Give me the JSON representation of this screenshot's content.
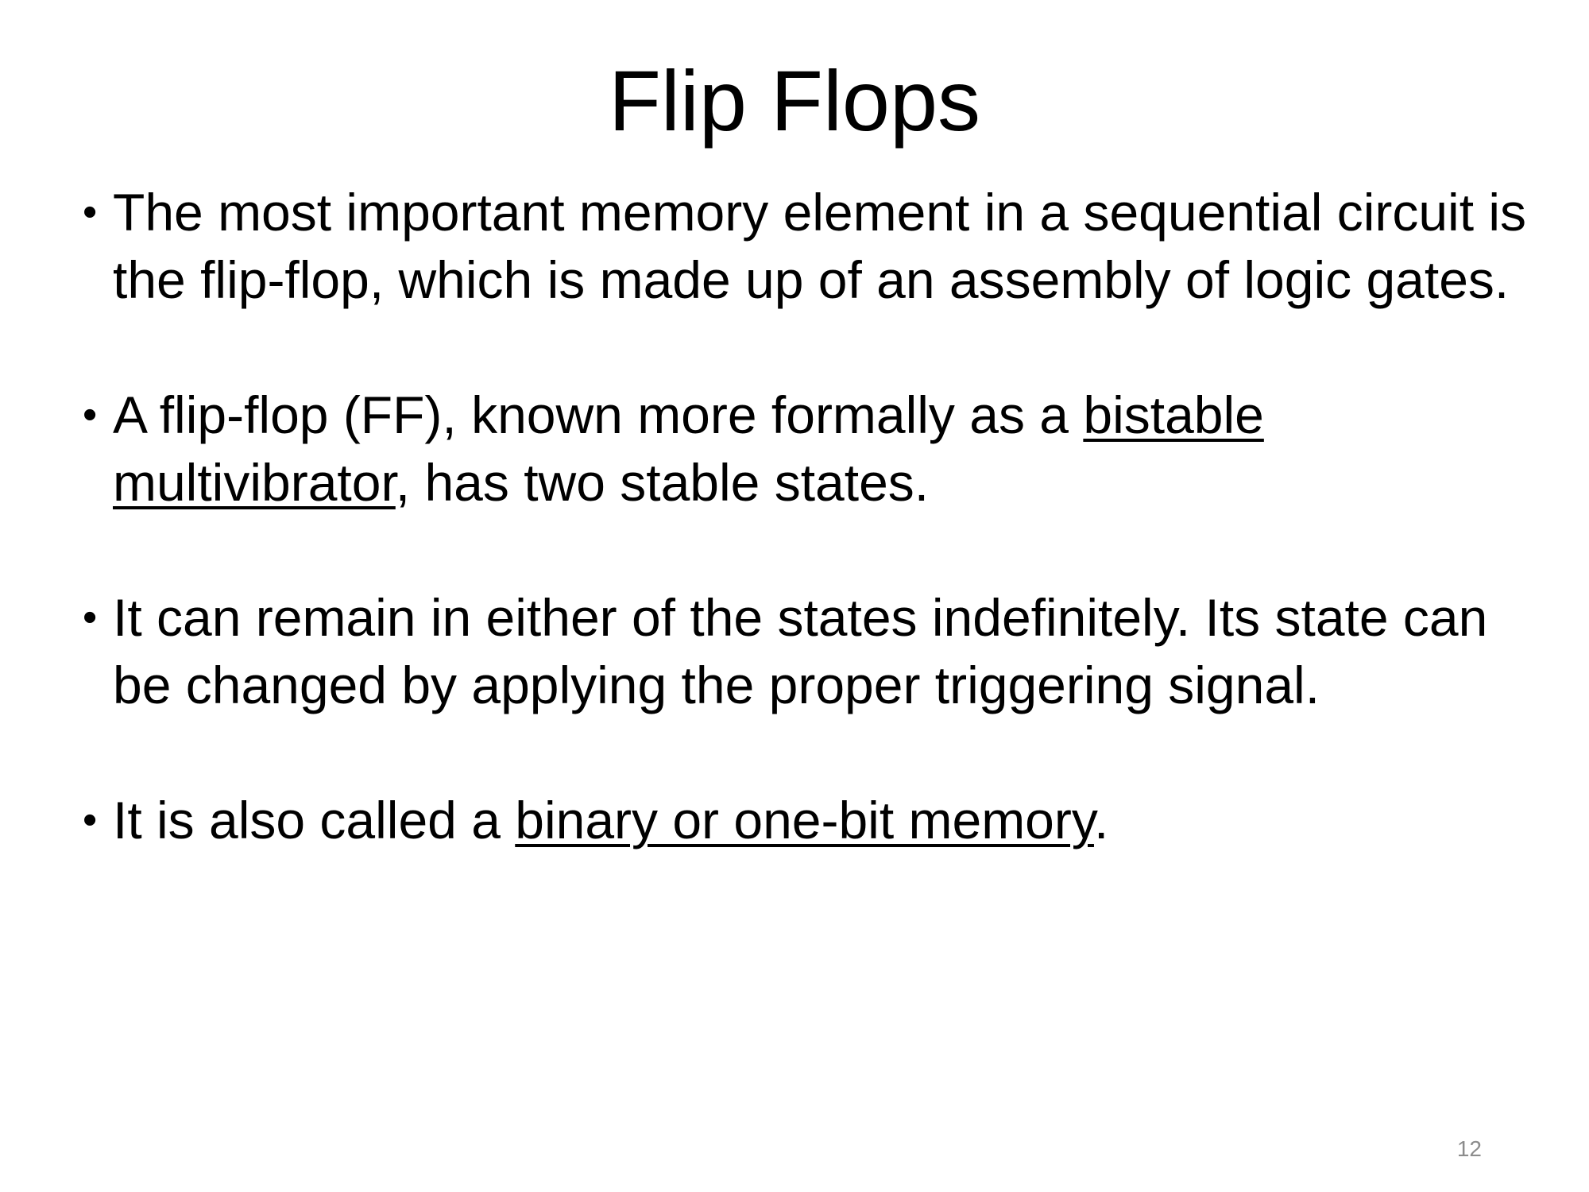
{
  "slide": {
    "title": "Flip Flops",
    "page_number": "12",
    "bullets": [
      {
        "text_before": "The most important memory element in a sequential circuit is the flip-flop, which is made up of an assembly of logic gates."
      },
      {
        "text_before": "A flip-flop (FF), known more formally as a ",
        "underlined": "bistable multivibrator",
        "text_after": ", has two stable states."
      },
      {
        "text_before": "It can remain in either of the states indefinitely. Its state can be changed by applying the proper triggering signal."
      },
      {
        "text_before": "It is also called a ",
        "underlined": "binary or one-bit memory",
        "text_after": "."
      }
    ],
    "bullet_glyph": "•"
  }
}
